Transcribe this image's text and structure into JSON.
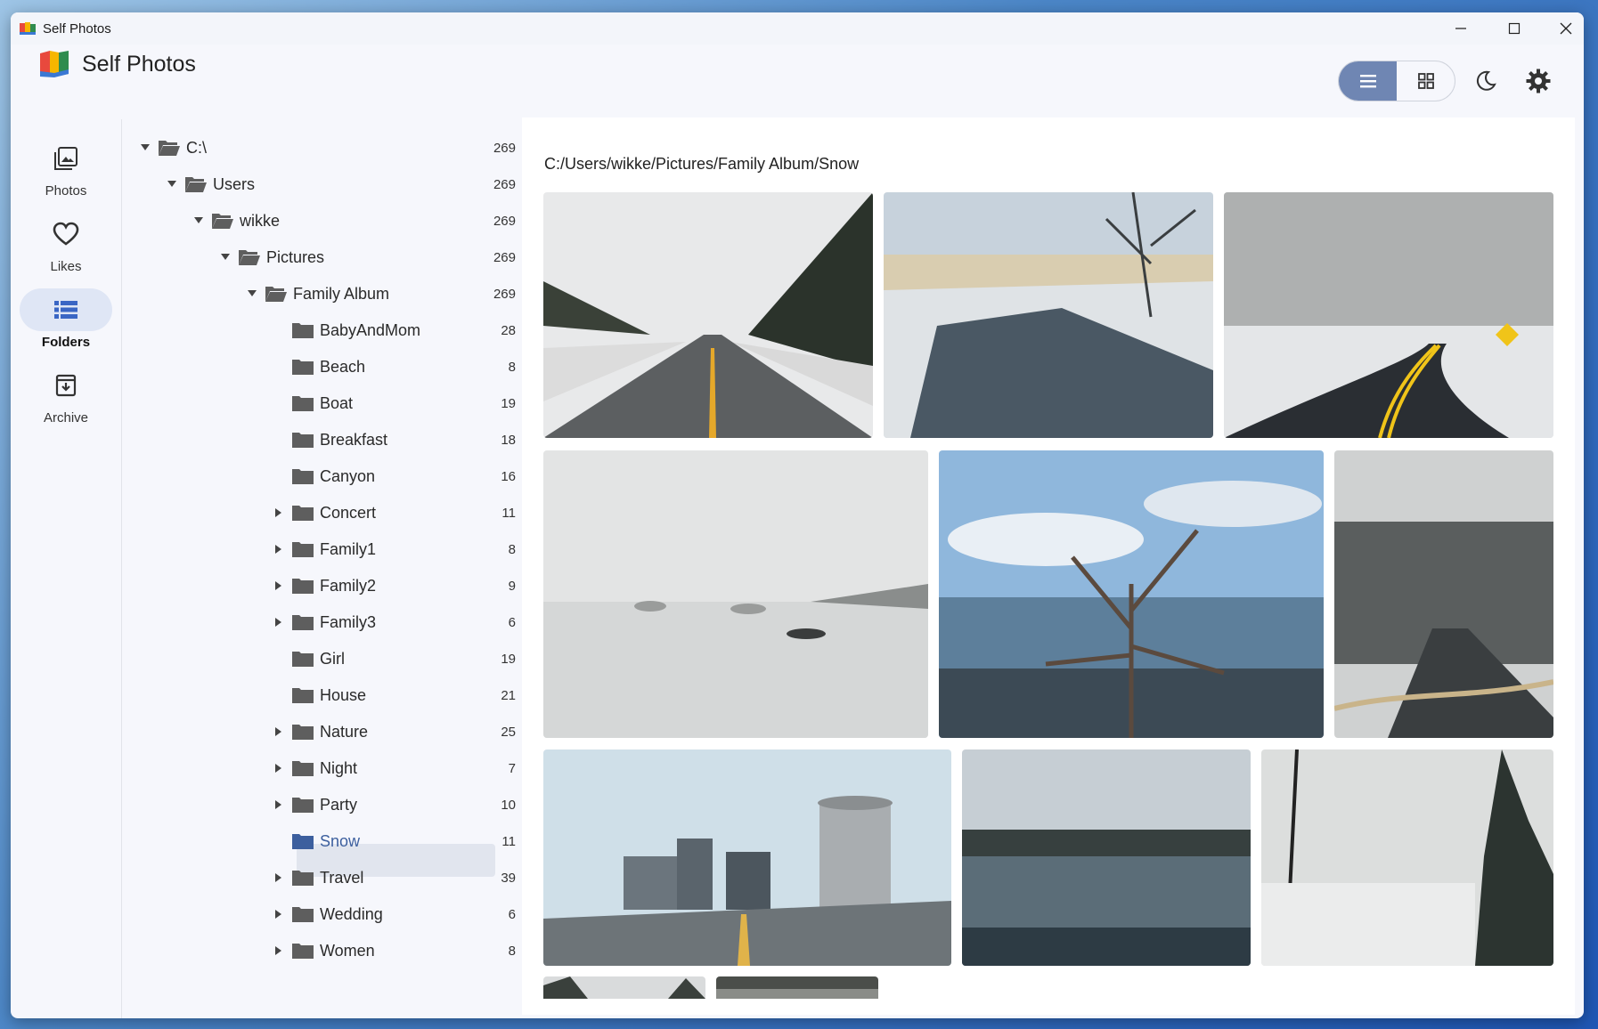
{
  "window": {
    "title": "Self Photos"
  },
  "app": {
    "title": "Self Photos"
  },
  "nav": [
    {
      "label": "Photos",
      "icon": "photos-icon"
    },
    {
      "label": "Likes",
      "icon": "heart-icon"
    },
    {
      "label": "Folders",
      "icon": "folders-icon"
    },
    {
      "label": "Archive",
      "icon": "archive-icon"
    }
  ],
  "nav_active": "Folders",
  "toolbar": {
    "list_view_icon": "list-view-icon",
    "grid_view_icon": "grid-view-icon",
    "theme_icon": "moon-icon",
    "settings_icon": "gear-icon",
    "active_view": "list"
  },
  "tree": [
    {
      "name": "C:\\",
      "count": "269",
      "expanded": true
    },
    {
      "name": "Users",
      "count": "269",
      "expanded": true
    },
    {
      "name": "wikke",
      "count": "269",
      "expanded": true
    },
    {
      "name": "Pictures",
      "count": "269",
      "expanded": true
    },
    {
      "name": "Family Album",
      "count": "269",
      "expanded": true
    },
    {
      "name": "BabyAndMom",
      "count": "28"
    },
    {
      "name": "Beach",
      "count": "8"
    },
    {
      "name": "Boat",
      "count": "19"
    },
    {
      "name": "Breakfast",
      "count": "18"
    },
    {
      "name": "Canyon",
      "count": "16"
    },
    {
      "name": "Concert",
      "count": "11",
      "collapsed": true
    },
    {
      "name": "Family1",
      "count": "8",
      "collapsed": true
    },
    {
      "name": "Family2",
      "count": "9",
      "collapsed": true
    },
    {
      "name": "Family3",
      "count": "6",
      "collapsed": true
    },
    {
      "name": "Girl",
      "count": "19"
    },
    {
      "name": "House",
      "count": "21"
    },
    {
      "name": "Nature",
      "count": "25",
      "collapsed": true
    },
    {
      "name": "Night",
      "count": "7",
      "collapsed": true
    },
    {
      "name": "Party",
      "count": "10",
      "collapsed": true
    },
    {
      "name": "Snow",
      "count": "11",
      "selected": true
    },
    {
      "name": "Travel",
      "count": "39",
      "collapsed": true
    },
    {
      "name": "Wedding",
      "count": "6",
      "collapsed": true
    },
    {
      "name": "Women",
      "count": "8",
      "collapsed": true
    }
  ],
  "content": {
    "path": "C:/Users/wikke/Pictures/Family Album/Snow"
  },
  "colors": {
    "accent": "#6f86b3",
    "selected_folder": "#3c5f9e",
    "folder": "#5e5e5e"
  }
}
